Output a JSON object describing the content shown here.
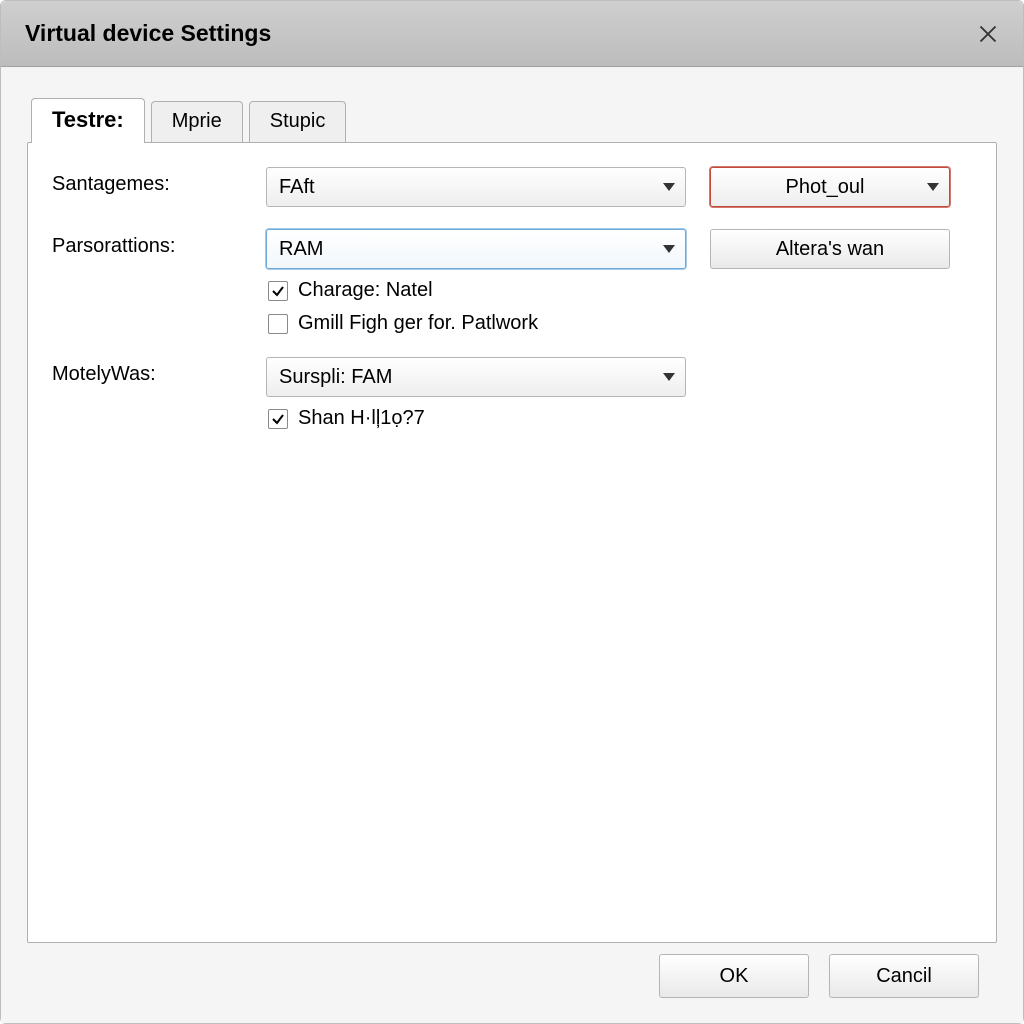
{
  "window": {
    "title": "Virtual device Settings"
  },
  "tabs": [
    {
      "label": "Testre:",
      "active": true
    },
    {
      "label": "Mprie",
      "active": false
    },
    {
      "label": "Stupic",
      "active": false
    }
  ],
  "rows": {
    "santagemes": {
      "label": "Santagemes:",
      "combo": "FAft",
      "side_combo": "Phot_oul"
    },
    "parsorattions": {
      "label": "Parsorattions:",
      "combo": "RAM",
      "side_button": "Altera's wan",
      "check1": {
        "label": "Charage: Natel",
        "checked": true
      },
      "check2": {
        "label": "Gmill Figh ger for. Patlwork",
        "checked": false
      }
    },
    "motelywas": {
      "label": "MotelyWas:",
      "combo": "Surspli: FAM",
      "check1": {
        "label": "Shan H·lļ1ọ?7",
        "checked": true
      }
    }
  },
  "footer": {
    "ok": "OK",
    "cancel": "Cancil"
  }
}
